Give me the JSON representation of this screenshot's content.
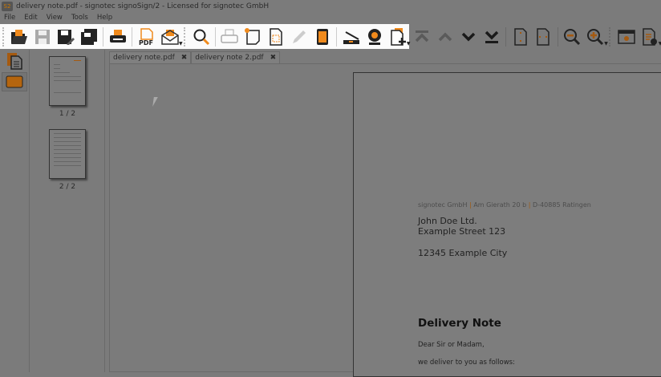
{
  "window": {
    "title": "delivery note.pdf - signotec signoSign/2 - Licensed for signotec GmbH",
    "icon_text": "S2"
  },
  "menu": [
    "File",
    "Edit",
    "View",
    "Tools",
    "Help"
  ],
  "toolbar": {
    "highlighted": [
      "open-icon",
      "save-icon",
      "save-as-icon",
      "save-all-icon",
      "print-icon",
      "pdf-export-icon",
      "email-icon",
      "search-icon",
      "print-disabled-icon",
      "new-note-icon",
      "select-area-icon",
      "pen-icon",
      "signature-pad-icon",
      "scanner-icon",
      "webcam-icon",
      "add-document-icon"
    ],
    "dimmed": [
      "first-page-icon",
      "previous-page-icon",
      "next-page-icon",
      "last-page-icon",
      "fit-page-icon",
      "fit-width-icon",
      "zoom-out-icon",
      "zoom-in-icon",
      "fullscreen-icon",
      "document-settings-icon"
    ]
  },
  "thumbnails": [
    {
      "label": "1 / 2"
    },
    {
      "label": "2 / 2"
    }
  ],
  "tabs": [
    {
      "label": "delivery note.pdf",
      "close": "✖"
    },
    {
      "label": "delivery note 2.pdf",
      "close": "✖"
    }
  ],
  "document": {
    "sender": [
      "signotec GmbH",
      "Am Gierath 20 b",
      "D-40885 Ratingen"
    ],
    "sender_sep": "|",
    "recipient_line1": "John Doe Ltd.",
    "recipient_line2": "Example Street 123",
    "recipient_city": "12345 Example City",
    "heading": "Delivery Note",
    "salutation": "Dear Sir or Madam,",
    "intro": "we deliver to you as follows:"
  }
}
